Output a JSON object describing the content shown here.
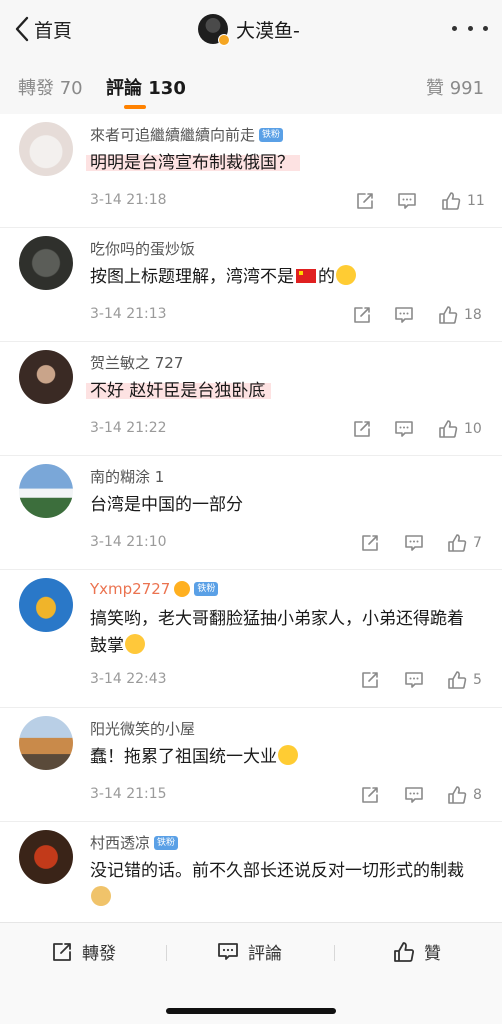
{
  "header": {
    "back_label": "首頁",
    "title": "大漠鱼-",
    "back_icon": "chevron-left-icon",
    "more_icon": "more-dots-icon"
  },
  "tabs": [
    {
      "label": "轉發 70"
    },
    {
      "label": "評論 130"
    },
    {
      "label": "贊 991"
    }
  ],
  "accent_color": "#ff8200",
  "comments": [
    {
      "user": "來者可追繼續繼續向前走",
      "badge": "铁粉",
      "text": "明明是台湾宣布制裁俄国？",
      "time": "3-14 21:18",
      "likes": "11"
    },
    {
      "user": "吃你吗的蛋炒饭",
      "badge": "",
      "text_a": "按图上标题理解，湾湾不是",
      "text_b": "的",
      "time": "3-14 21:13",
      "likes": "18"
    },
    {
      "user": "贺兰敏之 727",
      "badge": "",
      "text": "不好 赵奸臣是台独卧底",
      "time": "3-14 21:22",
      "likes": "10"
    },
    {
      "user": "南的糊涂 1",
      "badge": "",
      "text": "台湾是中国的一部分",
      "time": "3-14 21:10",
      "likes": "7"
    },
    {
      "user": "Yxmp2727",
      "badge": "铁粉",
      "text": "搞笑哟，老大哥翻脸猛抽小弟家人，小弟还得跪着鼓掌",
      "time": "3-14 22:43",
      "likes": "5"
    },
    {
      "user": "阳光微笑的小屋",
      "badge": "",
      "text": "蠢！拖累了祖国统一大业",
      "time": "3-14 21:15",
      "likes": "8"
    },
    {
      "user": "村西透凉",
      "badge": "铁粉",
      "text": "没记错的话。前不久部长还说反对一切形式的制裁",
      "time": "",
      "likes": ""
    }
  ],
  "bottom": {
    "repost_label": "轉發",
    "comment_label": "評論",
    "like_label": "贊"
  }
}
